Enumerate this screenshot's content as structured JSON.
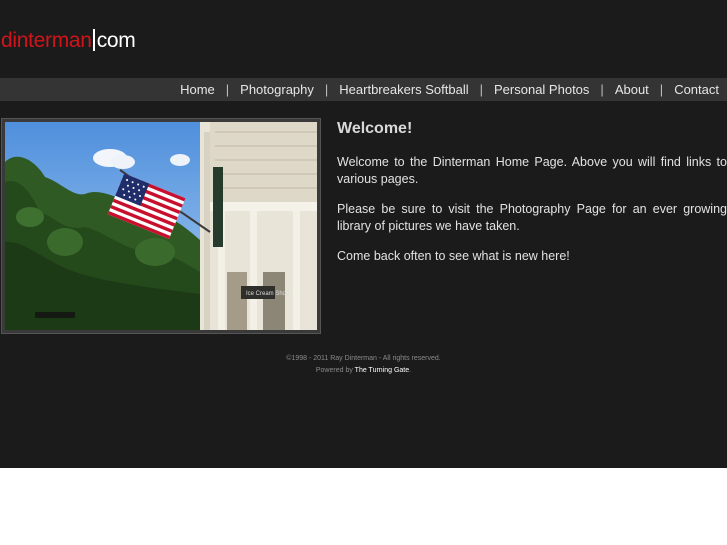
{
  "logo": {
    "part1": "dinterman",
    "part2": "com"
  },
  "nav": {
    "items": [
      "Home",
      "Photography",
      "Heartbreakers Softball",
      "Personal Photos",
      "About",
      "Contact"
    ],
    "divider": "|"
  },
  "photo": {
    "sign_text": "Ice Cream Shop"
  },
  "main": {
    "title": "Welcome!",
    "paragraphs": [
      "Welcome to the Dinterman Home Page. Above you will find links to various pages.",
      "Please be sure to visit the Photography Page for an ever growing library of pictures we have taken.",
      "Come back often to see what is new here!"
    ]
  },
  "footer": {
    "copyright": "©1998 - 2011 Ray Dinterman - All rights reserved.",
    "powered_prefix": "Powered by ",
    "powered_link": "The Turning Gate",
    "powered_suffix": "."
  },
  "colors": {
    "background": "#1b1b1b",
    "navbar": "#343434",
    "logo_red": "#d0141b"
  }
}
